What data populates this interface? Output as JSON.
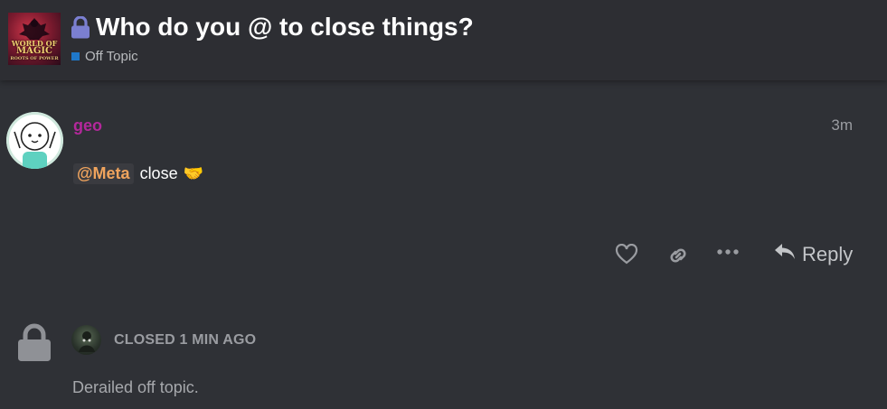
{
  "header": {
    "logo_line1": "WORLD OF",
    "logo_line2": "MAGIC",
    "logo_line3": "ROOTS OF POWER",
    "title": "Who do you @ to close things?",
    "category": "Off Topic",
    "category_color": "#1f77c8"
  },
  "post": {
    "username": "geo",
    "username_color": "#b3289b",
    "time": "3m",
    "mention": "@Meta",
    "text": "close",
    "emoji": "🤝",
    "actions": {
      "like_icon": "heart-icon",
      "link_icon": "link-icon",
      "more_icon": "more-icon",
      "reply_label": "Reply"
    }
  },
  "small_action": {
    "icon": "lock-icon",
    "label": "CLOSED 1 MIN AGO",
    "reason": "Derailed off topic."
  }
}
